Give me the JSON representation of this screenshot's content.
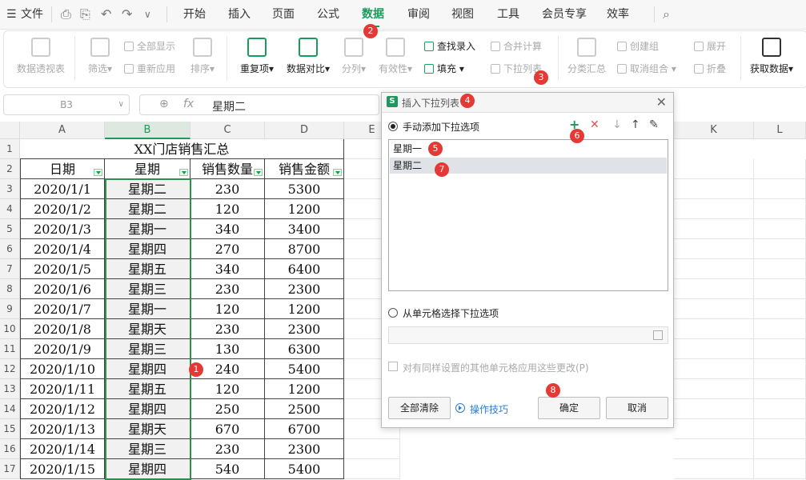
{
  "menubar": {
    "file": "文件",
    "tabs": [
      "开始",
      "插入",
      "页面",
      "公式",
      "数据",
      "审阅",
      "视图",
      "工具",
      "会员专享",
      "效率"
    ]
  },
  "ribbon": {
    "pivot": "数据透视表",
    "filter": "筛选",
    "show_all": "全部显示",
    "reapply": "重新应用",
    "sort": "排序",
    "duplicates": "重复项",
    "compare": "数据对比",
    "split": "分列",
    "validity": "有效性",
    "lookup_entry": "查找录入",
    "fill": "填充",
    "consolidate": "合并计算",
    "dropdown_list": "下拉列表",
    "subtotal": "分类汇总",
    "create_group": "创建组",
    "ungroup": "取消组合",
    "expand": "展开",
    "collapse": "折叠",
    "get_data": "获取数据"
  },
  "formula_bar": {
    "name_box": "B3",
    "fx": "fx",
    "value": "星期二"
  },
  "sheet": {
    "columns": [
      "A",
      "B",
      "C",
      "D",
      "E",
      "K",
      "L"
    ],
    "title": "XX门店销售汇总",
    "headers": [
      "日期",
      "星期",
      "销售数量",
      "销售金额"
    ],
    "rows": [
      [
        "2020/1/1",
        "星期二",
        "230",
        "5300"
      ],
      [
        "2020/1/2",
        "星期二",
        "120",
        "1200"
      ],
      [
        "2020/1/3",
        "星期一",
        "340",
        "3400"
      ],
      [
        "2020/1/4",
        "星期四",
        "270",
        "8700"
      ],
      [
        "2020/1/5",
        "星期五",
        "340",
        "6400"
      ],
      [
        "2020/1/6",
        "星期三",
        "230",
        "2300"
      ],
      [
        "2020/1/7",
        "星期一",
        "120",
        "1200"
      ],
      [
        "2020/1/8",
        "星期天",
        "230",
        "2300"
      ],
      [
        "2020/1/9",
        "星期三",
        "130",
        "6300"
      ],
      [
        "2020/1/10",
        "星期四",
        "240",
        "5400"
      ],
      [
        "2020/1/11",
        "星期五",
        "120",
        "1200"
      ],
      [
        "2020/1/12",
        "星期四",
        "250",
        "2500"
      ],
      [
        "2020/1/13",
        "星期天",
        "670",
        "6700"
      ],
      [
        "2020/1/14",
        "星期三",
        "230",
        "2300"
      ],
      [
        "2020/1/15",
        "星期四",
        "540",
        "5400"
      ]
    ]
  },
  "dialog": {
    "title": "插入下拉列表",
    "manual_option": "手动添加下拉选项",
    "items": [
      "星期一",
      "星期二"
    ],
    "from_cell_option": "从单元格选择下拉选项",
    "apply_checkbox": "对有同样设置的其他单元格应用这些更改(P)",
    "clear_all": "全部清除",
    "tips": "操作技巧",
    "ok": "确定",
    "cancel": "取消"
  },
  "markers": [
    "1",
    "2",
    "3",
    "4",
    "5",
    "6",
    "7",
    "8"
  ],
  "colors": {
    "accent": "#1c9a5c",
    "marker": "#e53935",
    "link": "#2a7bd4"
  }
}
